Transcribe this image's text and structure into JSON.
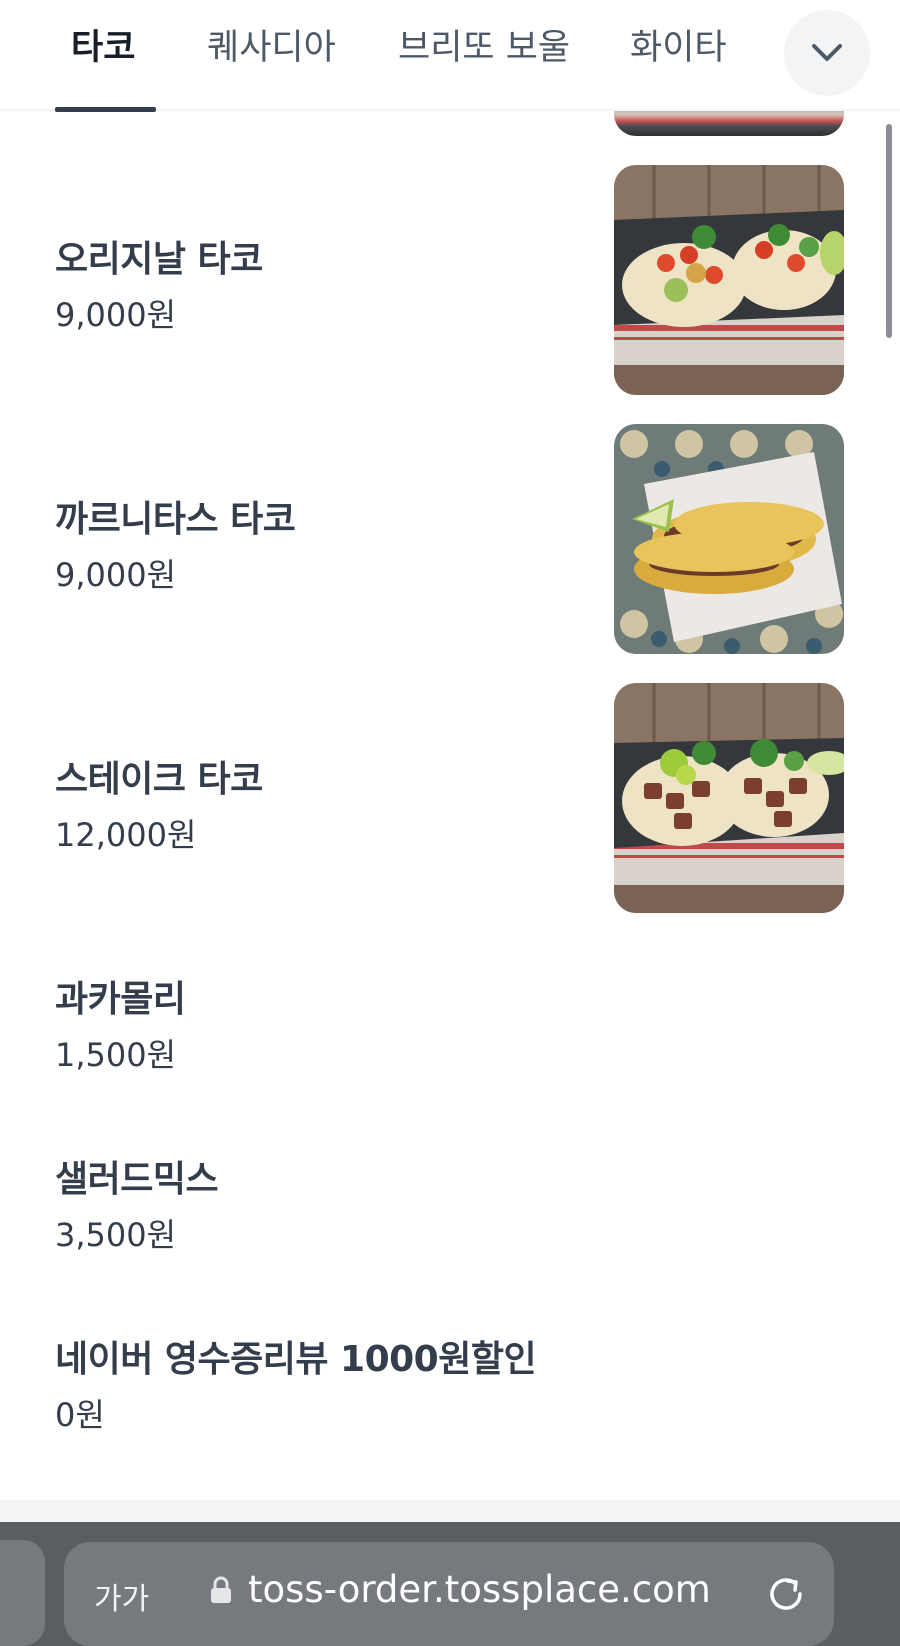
{
  "tabs": [
    {
      "label": "타코",
      "active": true
    },
    {
      "label": "퀘사디아",
      "active": false
    },
    {
      "label": "브리또 보울",
      "active": false
    },
    {
      "label": "화이타",
      "active": false
    }
  ],
  "expand_icon": "chevron-down-icon",
  "menu": [
    {
      "name": "오리지날 타코",
      "price": "9,000원",
      "has_image": true
    },
    {
      "name": "까르니타스 타코",
      "price": "9,000원",
      "has_image": true
    },
    {
      "name": "스테이크 타코",
      "price": "12,000원",
      "has_image": true
    },
    {
      "name": "과카몰리",
      "price": "1,500원",
      "has_image": false
    },
    {
      "name": "샐러드믹스",
      "price": "3,500원",
      "has_image": false
    },
    {
      "name": "네이버 영수증리뷰 1000원할인",
      "price": "0원",
      "has_image": false
    }
  ],
  "browser": {
    "text_size_label": "가가",
    "url": "toss-order.tossplace.com",
    "lock_icon": "lock-icon",
    "reload_icon": "reload-icon"
  },
  "colors": {
    "text_primary": "#333d4b",
    "tab_inactive": "#4e5968",
    "chrome_bg": "#5a5d62",
    "urlbar_bg": "#76797e"
  }
}
